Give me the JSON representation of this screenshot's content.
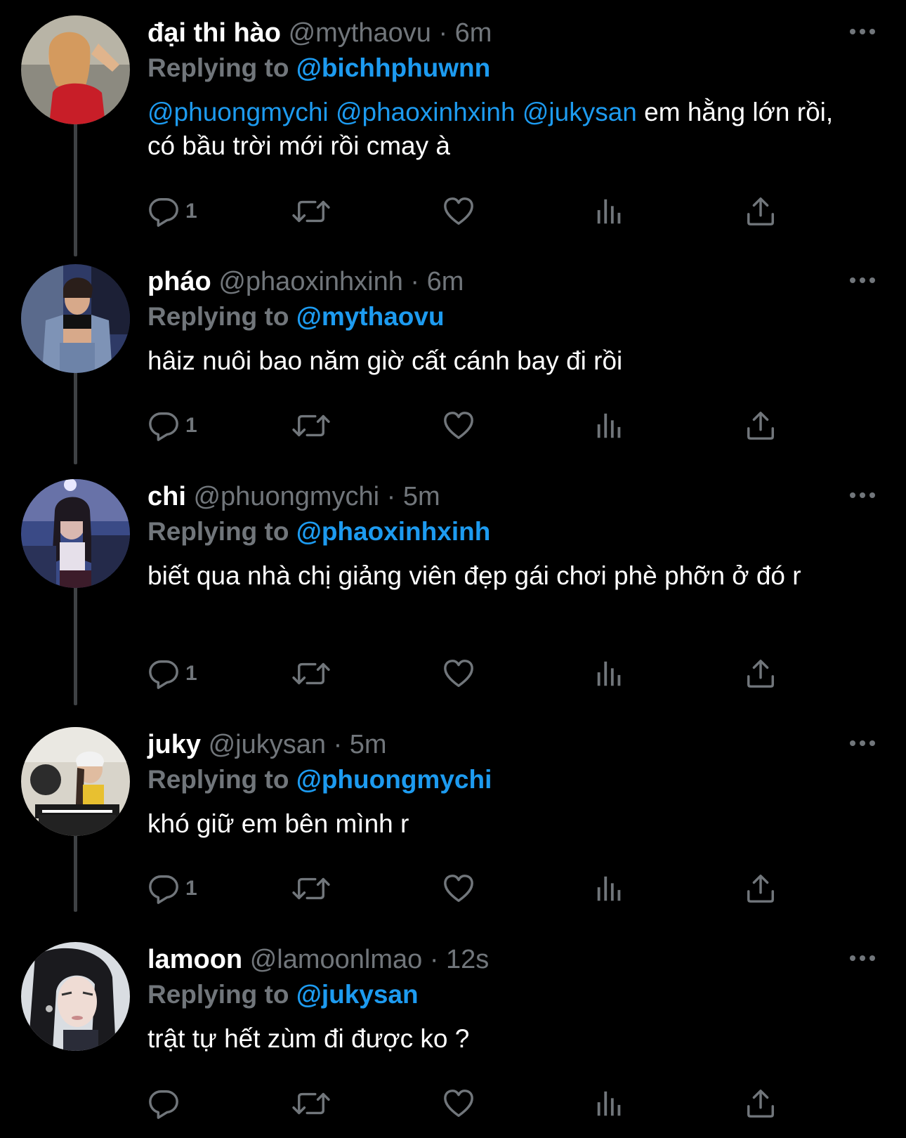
{
  "theme": {
    "background": "#000000",
    "text_primary": "#ffffff",
    "text_secondary": "#71767b",
    "link": "#1d9bf0",
    "thread_line": "#3e4144"
  },
  "replying_label": "Replying to",
  "tweets": [
    {
      "display_name": "đại thi hào",
      "handle_time": "@mythaovu · 6m",
      "reply_to": "@bichhphuwnn",
      "mentions": [
        "@phuongmychi",
        "@phaoxinhxinh",
        "@jukysan"
      ],
      "text": "em hằng lớn rồi, có bầu trời mới rồi cmay à",
      "reply_count": "1"
    },
    {
      "display_name": "pháo",
      "handle_time": "@phaoxinhxinh · 6m",
      "reply_to": "@mythaovu",
      "text": "hâiz nuôi bao năm giờ cất cánh bay đi rồi",
      "reply_count": "1"
    },
    {
      "display_name": "chi",
      "handle_time": "@phuongmychi · 5m",
      "reply_to": "@phaoxinhxinh",
      "text": "biết qua nhà chị giảng viên đẹp gái chơi phè phỡn ở đó r",
      "reply_count": "1"
    },
    {
      "display_name": "juky",
      "handle_time": "@jukysan · 5m",
      "reply_to": "@phuongmychi",
      "text": "khó giữ em bên mình r",
      "reply_count": "1"
    },
    {
      "display_name": "lamoon",
      "handle_time": "@lamoonlmao · 12s",
      "reply_to": "@jukysan",
      "text": "trật tự hết zùm đi được ko ?",
      "reply_count": ""
    }
  ],
  "icons": {
    "reply": "reply-icon",
    "retweet": "retweet-icon",
    "like": "heart-icon",
    "views": "views-icon",
    "share": "share-icon",
    "more": "more-icon"
  }
}
